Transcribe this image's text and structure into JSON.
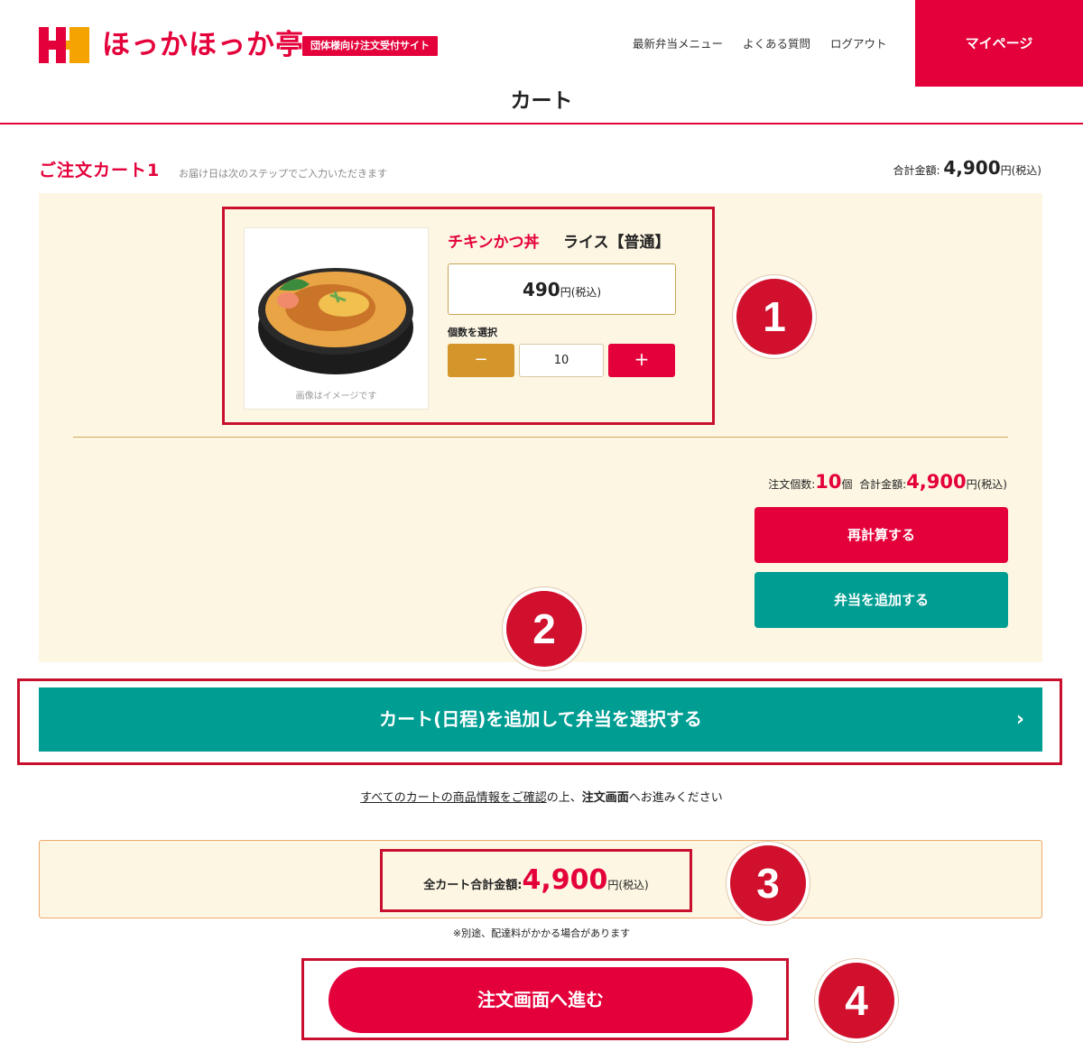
{
  "header": {
    "logo_text": "ほっかほっか亭",
    "logo_tag": "団体様向け注文受付サイト",
    "nav": [
      "最新弁当メニュー",
      "よくある質問",
      "ログアウト"
    ],
    "mypage": "マイページ",
    "page_title": "カート"
  },
  "cart": {
    "title": "ご注文カート1",
    "note": "お届け日は次のステップでご入力いただきます",
    "total_label": "合計金額:",
    "total_value": "4,900",
    "total_suffix": "円(税込)",
    "item": {
      "name": "チキンかつ丼",
      "option": "ライス【普通】",
      "price": "490",
      "price_suffix": "円(税込)",
      "image_caption": "画像はイメージです",
      "qty_label": "個数を選択",
      "minus": "−",
      "quantity": "10",
      "plus": "+"
    },
    "summary": {
      "count_label": "注文個数:",
      "count": "10",
      "count_unit": "個",
      "total_label": "合計金額:",
      "total": "4,900",
      "total_suffix": "円(税込)"
    },
    "recalc_button": "再計算する",
    "add_bento_button": "弁当を追加する"
  },
  "add_cart_button": "カート(日程)を追加して弁当を選択する",
  "add_cart_chevron": "›",
  "confirm": {
    "link": "すべてのカートの商品情報をご確認",
    "text1": "の上、",
    "bold": "注文画面",
    "text2": "へお進みください"
  },
  "grand_total": {
    "label": "全カート合計金額:",
    "value": "4,900",
    "suffix": "円(税込)"
  },
  "shipping_note": "※別途、配達料がかかる場合があります",
  "order_button": "注文画面へ進む",
  "callouts": [
    "1",
    "2",
    "3",
    "4"
  ],
  "colors": {
    "brand_red": "#e4003a",
    "teal": "#009d92",
    "mustard": "#d4952a",
    "cream": "#fdf6e3"
  }
}
